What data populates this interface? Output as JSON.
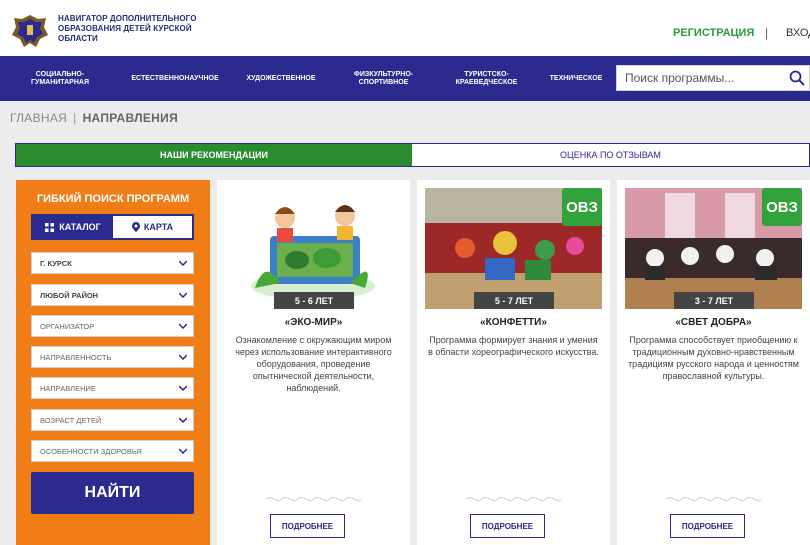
{
  "header": {
    "brand_lines": [
      "НАВИГАТОР ДОПОЛНИТЕЛЬНОГО",
      "ОБРАЗОВАНИЯ ДЕТЕЙ КУРСКОЙ",
      "ОБЛАСТИ"
    ],
    "register_label": "РЕГИСТРАЦИЯ",
    "separator": "|",
    "login_label": "ВХОД"
  },
  "nav": {
    "items": [
      {
        "label": "СОЦИАЛЬНО-\nГУМАНИТАРНАЯ"
      },
      {
        "label": "ЕСТЕСТВЕННОНАУЧНОЕ"
      },
      {
        "label": "ХУДОЖЕСТВЕННОЕ"
      },
      {
        "label": "ФИЗКУЛЬТУРНО-\nСПОРТИВНОЕ"
      },
      {
        "label": "ТУРИСТСКО-\nКРАЕВЕДЧЕСКОЕ"
      },
      {
        "label": "ТЕХНИЧЕСКОЕ"
      }
    ],
    "search_placeholder": "Поиск программы...",
    "search_icon": "search-icon"
  },
  "breadcrumb": {
    "home": "ГЛАВНАЯ",
    "separator": "|",
    "current": "НАПРАВЛЕНИЯ"
  },
  "toggle": {
    "left_label": "НАШИ РЕКОМЕНДАЦИИ",
    "right_label": "ОЦЕНКА ПО ОТЗЫВАМ"
  },
  "filter": {
    "title": "ГИБКИЙ ПОИСК ПРОГРАММ",
    "tab_catalog": "КАТАЛОГ",
    "tab_map": "КАРТА",
    "selects": [
      {
        "value": "Г. КУРСК"
      },
      {
        "value": "ЛЮБОЙ РАЙОН"
      },
      {
        "value": "ОРГАНИЗАТОР"
      },
      {
        "value": "НАПРАВЛЕННОСТЬ"
      },
      {
        "value": "НАПРАВЛЕНИЕ"
      },
      {
        "value": "ВОЗРАСТ ДЕТЕЙ"
      },
      {
        "value": "ОСОБЕННОСТИ ЗДОРОВЬЯ"
      }
    ],
    "find_label": "НАЙТИ"
  },
  "cards": [
    {
      "age": "5 - 6 ЛЕТ",
      "badge": "",
      "title": "«ЭКО-МИР»",
      "description": "Ознакомление с окружающим миром через использование интерактивного оборудования, проведение опытнической деятельности, наблюдений.",
      "more_label": "ПОДРОБНЕЕ"
    },
    {
      "age": "5 - 7 ЛЕТ",
      "badge": "ОВЗ",
      "title": "«КОНФЕТТИ»",
      "description": "Программа формирует знания и умения в области хореографического искусства.",
      "more_label": "ПОДРОБНЕЕ"
    },
    {
      "age": "3 - 7 ЛЕТ",
      "badge": "ОВЗ",
      "title": "«СВЕТ ДОБРА»",
      "description": "Программа способствует приобщению к традиционным духовно-нравственным традициям русского народа и ценностям православной культуры.",
      "more_label": "ПОДРОБНЕЕ"
    }
  ],
  "colors": {
    "nav": "#2a2a8f",
    "accent_green": "#2a8c2e",
    "filter_orange": "#f07d16",
    "badge_green": "#31a33a"
  }
}
